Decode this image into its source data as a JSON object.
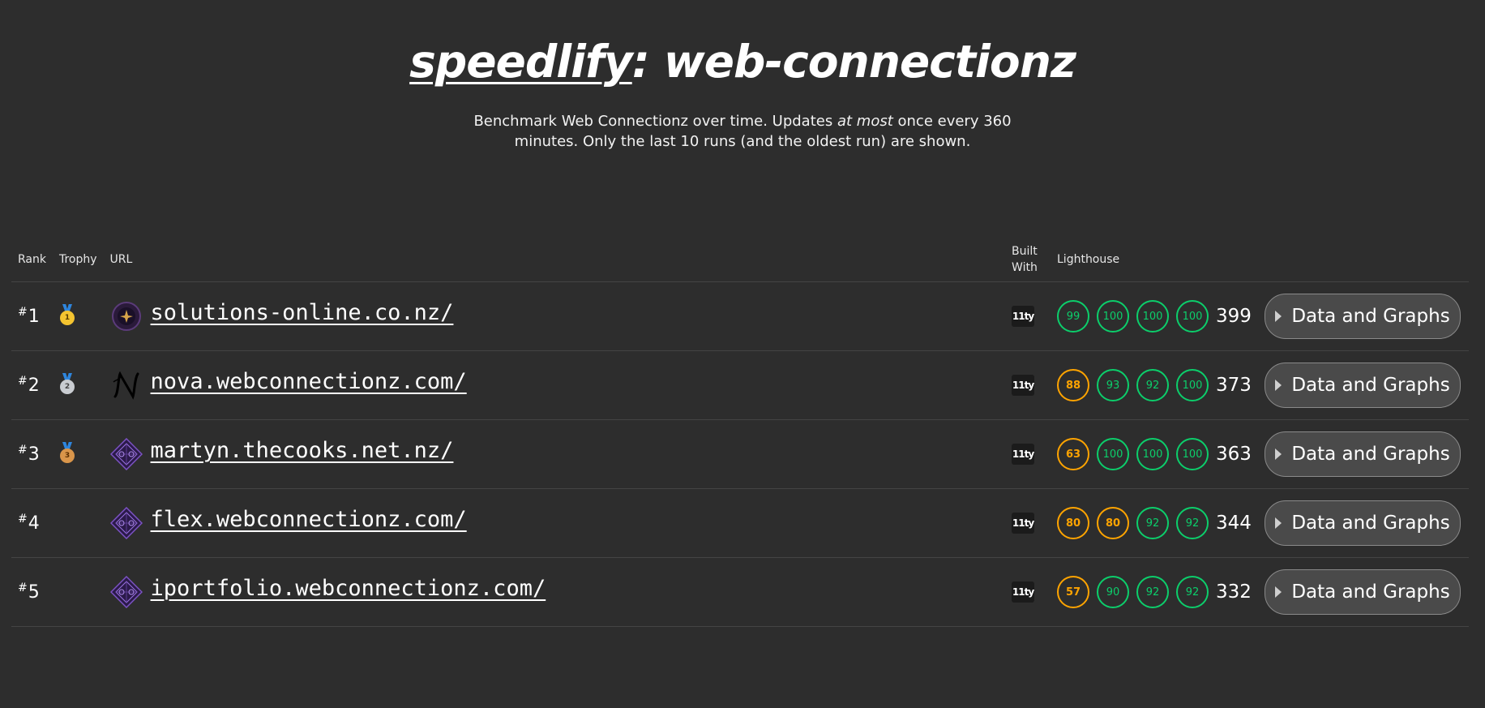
{
  "header": {
    "brand": "speedlify",
    "title_suffix": ": web-connectionz",
    "subtitle_part1": "Benchmark Web Connectionz over time. Updates",
    "subtitle_em": "at most",
    "subtitle_part2": "once every 360 minutes. Only the last 10 runs (and the oldest run) are shown."
  },
  "table": {
    "headers": {
      "rank": "Rank",
      "trophy": "Trophy",
      "url": "URL",
      "built_with": "Built With",
      "lighthouse": "Lighthouse"
    },
    "rows": [
      {
        "rank_symbol": "#",
        "rank": "1",
        "trophy": "1",
        "trophy_type": "gold",
        "icon": "solutions-online-logo-icon",
        "url": " solutions-online.co.nz/",
        "built_with": "11ty",
        "scores": [
          "99",
          "100",
          "100",
          "100"
        ],
        "score_colors": [
          "#0cce6b",
          "#0cce6b",
          "#0cce6b",
          "#0cce6b"
        ],
        "total": "399",
        "button": "Data and Graphs"
      },
      {
        "rank_symbol": "#",
        "rank": "2",
        "trophy": "2",
        "trophy_type": "silver",
        "icon": "nova-n-logo-icon",
        "url": " nova.webconnectionz.com/",
        "built_with": "11ty",
        "scores": [
          "88",
          "93",
          "92",
          "100"
        ],
        "score_colors": [
          "#ffa400",
          "#0cce6b",
          "#0cce6b",
          "#0cce6b"
        ],
        "total": "373",
        "button": "Data and Graphs"
      },
      {
        "rank_symbol": "#",
        "rank": "3",
        "trophy": "3",
        "trophy_type": "bronze",
        "icon": "diamond-logo-icon",
        "url": " martyn.thecooks.net.nz/",
        "built_with": "11ty",
        "scores": [
          "63",
          "100",
          "100",
          "100"
        ],
        "score_colors": [
          "#ffa400",
          "#0cce6b",
          "#0cce6b",
          "#0cce6b"
        ],
        "total": "363",
        "button": "Data and Graphs"
      },
      {
        "rank_symbol": "#",
        "rank": "4",
        "trophy": "",
        "trophy_type": "",
        "icon": "diamond-logo-icon",
        "url": " flex.webconnectionz.com/",
        "built_with": "11ty",
        "scores": [
          "80",
          "80",
          "92",
          "92"
        ],
        "score_colors": [
          "#ffa400",
          "#ffa400",
          "#0cce6b",
          "#0cce6b"
        ],
        "total": "344",
        "button": "Data and Graphs"
      },
      {
        "rank_symbol": "#",
        "rank": "5",
        "trophy": "",
        "trophy_type": "",
        "icon": "diamond-logo-icon",
        "url": " iportfolio.webconnectionz.com/",
        "built_with": "11ty",
        "scores": [
          "57",
          "90",
          "92",
          "92"
        ],
        "score_colors": [
          "#ffa400",
          "#0cce6b",
          "#0cce6b",
          "#0cce6b"
        ],
        "total": "332",
        "button": "Data and Graphs"
      }
    ]
  },
  "colors": {
    "background": "#2d2d2d",
    "score_good": "#0cce6b",
    "score_average": "#ffa400",
    "text": "#ffffff"
  }
}
